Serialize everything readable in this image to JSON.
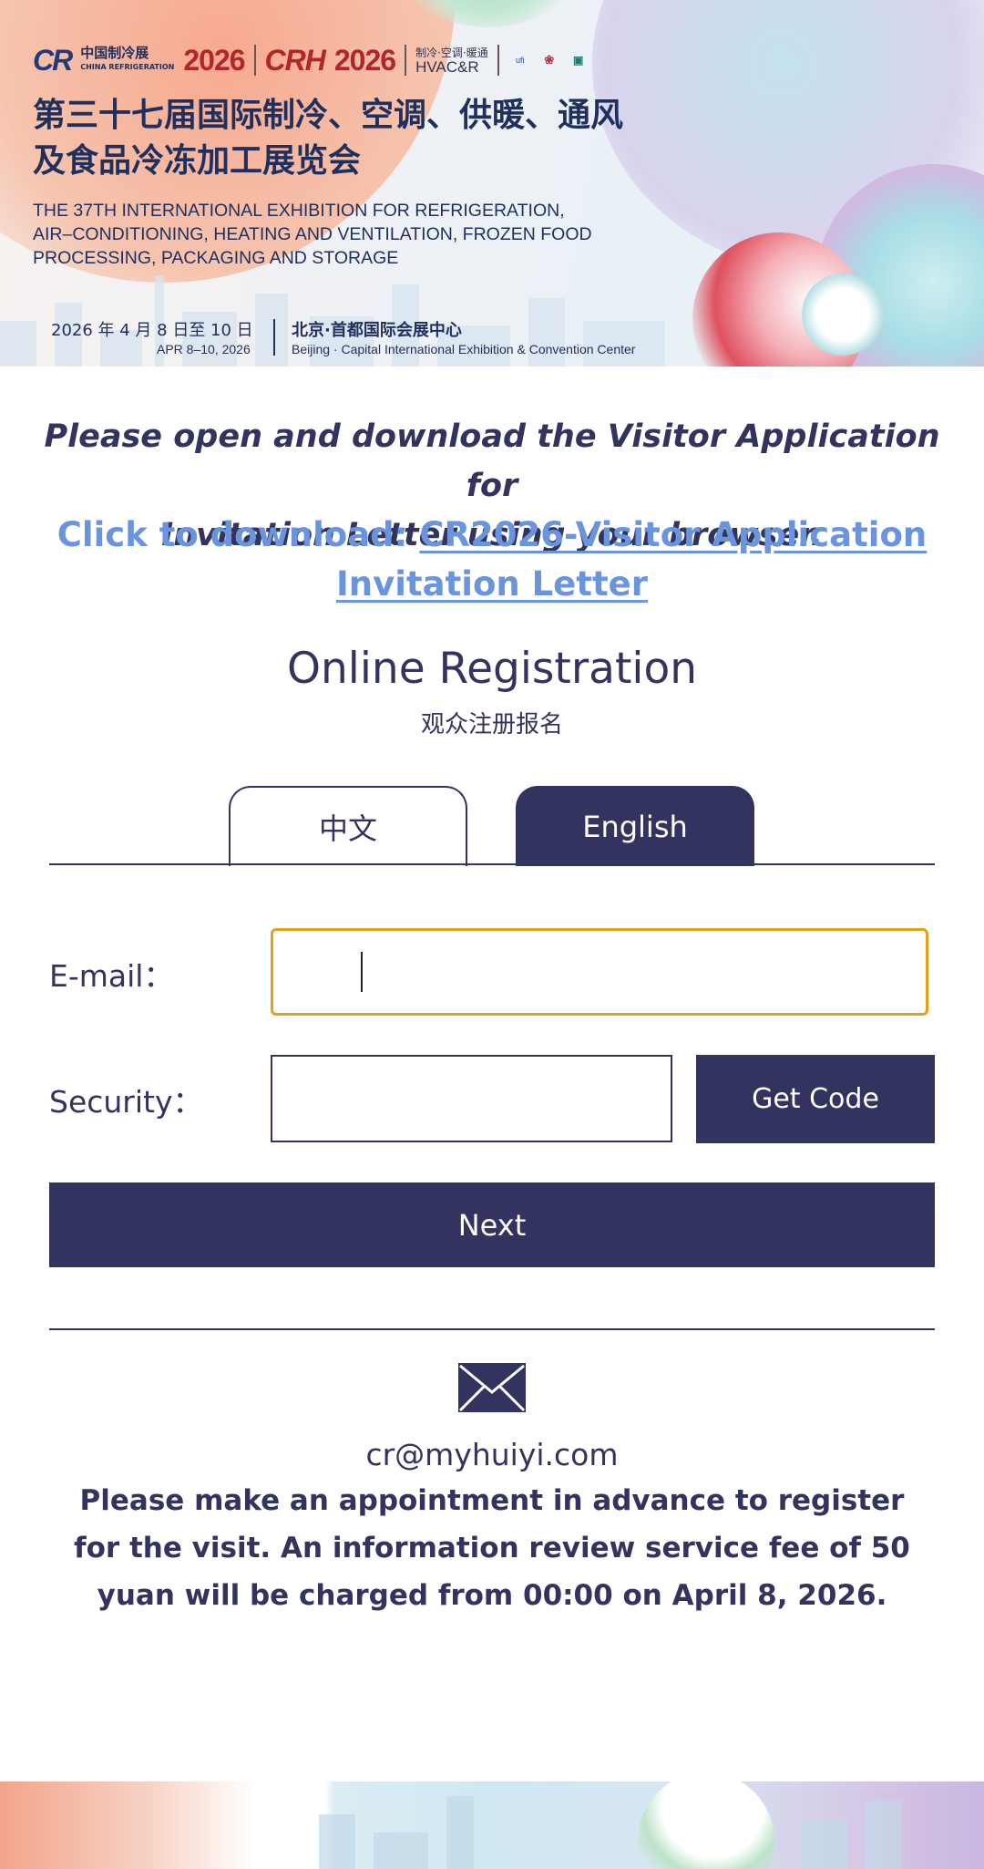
{
  "banner": {
    "logo_cr": "CR",
    "logo_cn_name": "中国制冷展",
    "logo_cn_sub": "CHINA REFRIGERATION",
    "logo_year": "2026",
    "logo_crh": "CRH",
    "logo_crh_year": "2026",
    "hvac_cn": "制冷·空调·暖通",
    "hvac_en": "HVAC&R",
    "badge_ufi": "ufi",
    "title_cn_line1": "第三十七届国际制冷、空调、供暖、通风",
    "title_cn_line2": "及食品冷冻加工展览会",
    "title_en_line1": "THE 37TH INTERNATIONAL EXHIBITION FOR REFRIGERATION,",
    "title_en_line2": "AIR–CONDITIONING, HEATING AND VENTILATION, FROZEN FOOD",
    "title_en_line3": "PROCESSING, PACKAGING AND STORAGE",
    "date_cn": "2026 年 4 月 8 日至 10 日",
    "date_en": "APR 8–10, 2026",
    "venue_cn": "北京·首都国际会展中心",
    "venue_en": "Beijing · Capital International Exhibition & Convention Center"
  },
  "notice": {
    "line1": "Please open and download the Visitor Application for",
    "line2": "Invitation Letter using your browser.",
    "download_prefix": "Click to download: ",
    "download_link": "CR2026-Visitor Application Invitation Letter"
  },
  "form": {
    "title": "Online Registration",
    "subtitle": "观众注册报名",
    "tabs": [
      {
        "label": "中文",
        "active": false
      },
      {
        "label": "English",
        "active": true
      }
    ],
    "email_label": "E-mail：",
    "email_value": "",
    "security_label": "Security：",
    "security_value": "",
    "get_code_label": "Get Code",
    "next_label": "Next"
  },
  "contact": {
    "icon": "envelope-icon",
    "email": "cr@myhuiyi.com",
    "note": "Please make an appointment in advance to register for the visit. An information review service fee of 50 yuan will be charged from 00:00 on April 8, 2026."
  },
  "colors": {
    "primary": "#33335f",
    "link": "#6a94de",
    "focus_border": "#e0a21a"
  }
}
